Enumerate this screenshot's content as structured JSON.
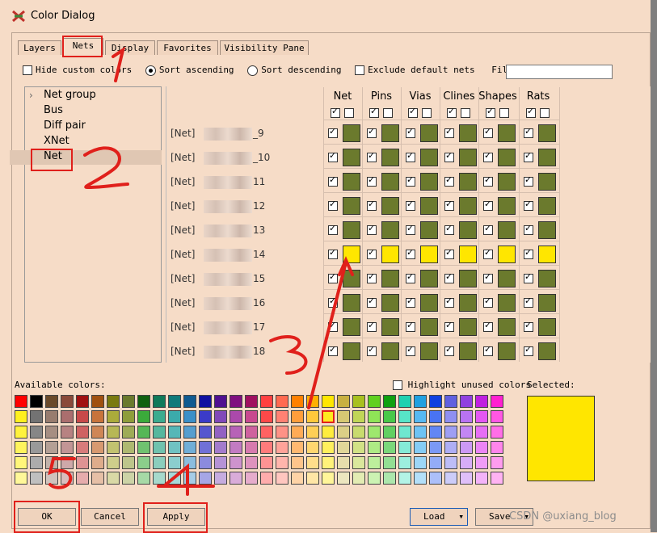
{
  "window": {
    "title": "Color Dialog"
  },
  "tabs": [
    "Layers",
    "Nets",
    "Display",
    "Favorites",
    "Visibility Pane"
  ],
  "options": {
    "hide_custom": "Hide custom colors",
    "sort_asc": "Sort ascending",
    "sort_desc": "Sort descending",
    "exclude_default": "Exclude default nets",
    "filter_label": "Filter nets:",
    "filter_value": ""
  },
  "tree": {
    "items": [
      "Net group",
      "Bus",
      "Diff pair",
      "XNet",
      "Net"
    ],
    "selected": "Net"
  },
  "columns": [
    "Net",
    "Pins",
    "Vias",
    "Clines",
    "Shapes",
    "Rats"
  ],
  "rows": [
    {
      "prefix": "[Net]",
      "suffix": "_9",
      "color": "olive"
    },
    {
      "prefix": "[Net]",
      "suffix": "_10",
      "color": "olive"
    },
    {
      "prefix": "[Net]",
      "suffix": "11",
      "color": "olive"
    },
    {
      "prefix": "[Net]",
      "suffix": "12",
      "color": "olive"
    },
    {
      "prefix": "[Net]",
      "suffix": "13",
      "color": "olive"
    },
    {
      "prefix": "[Net]",
      "suffix": "14",
      "color": "yellow"
    },
    {
      "prefix": "[Net]",
      "suffix": "15",
      "color": "olive"
    },
    {
      "prefix": "[Net]",
      "suffix": "16",
      "color": "olive"
    },
    {
      "prefix": "[Net]",
      "suffix": "17",
      "color": "olive"
    },
    {
      "prefix": "[Net]",
      "suffix": "18",
      "color": "olive"
    }
  ],
  "colors": {
    "olive": "#6b7a2d",
    "yellow": "#ffe600",
    "annotation": "#e0201b"
  },
  "palette": {
    "label": "Available colors:",
    "highlight_unused": "Highlight unused colors",
    "selected_label": "Selected:"
  },
  "buttons": {
    "ok": "OK",
    "cancel": "Cancel",
    "apply": "Apply",
    "load": "Load",
    "save": "Save"
  },
  "annotations": [
    "1",
    "2",
    "3",
    "4",
    "5"
  ],
  "watermark": "CSDN @uxiang_blog"
}
